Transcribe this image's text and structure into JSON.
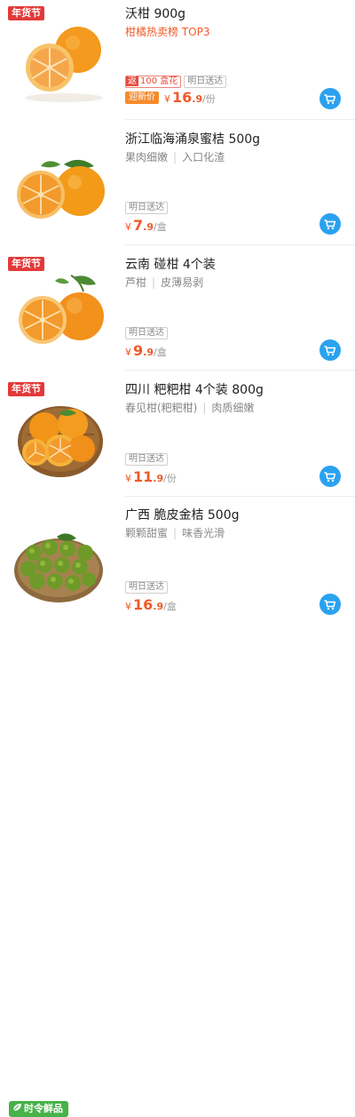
{
  "items": [
    {
      "title": "沃柑 900g",
      "subtitle": "柑橘热卖榜 TOP3",
      "festival_badge": "年货节",
      "coupon_lead": "返",
      "coupon_text": "100 盒花",
      "delivery": "明日送达",
      "new_price_tag": "迎新价",
      "currency": "¥",
      "price_int": "16",
      "price_dec": ".9",
      "unit": "/份"
    },
    {
      "title": "浙江临海涌泉蜜桔 500g",
      "features": [
        "果肉细嫩",
        "入口化渣"
      ],
      "delivery": "明日送达",
      "currency": "¥",
      "price_int": "7",
      "price_dec": ".9",
      "unit": "/盒"
    },
    {
      "title": "云南 碰柑 4个装",
      "features": [
        "芦柑",
        "皮薄易剥"
      ],
      "festival_badge": "年货节",
      "delivery": "明日送达",
      "currency": "¥",
      "price_int": "9",
      "price_dec": ".9",
      "unit": "/盒"
    },
    {
      "title": "四川 粑粑柑 4个装 800g",
      "features": [
        "春见柑(粑粑柑)",
        "肉质细嫩"
      ],
      "festival_badge": "年货节",
      "delivery": "明日送达",
      "currency": "¥",
      "price_int": "11",
      "price_dec": ".9",
      "unit": "/份"
    },
    {
      "title": "广西 脆皮金桔 500g",
      "features": [
        "颗颗甜蜜",
        "味香光滑"
      ],
      "fresh_badge": "时令鲜品",
      "delivery": "明日送达",
      "currency": "¥",
      "price_int": "16",
      "price_dec": ".9",
      "unit": "/盒"
    }
  ],
  "colors": {
    "price": "#f05a28",
    "cart": "#2aa2f0",
    "festival": "#e23a3a",
    "fresh": "#47b14a"
  },
  "icons": {
    "cart": "shopping-cart-icon",
    "leaf": "leaf-icon"
  }
}
